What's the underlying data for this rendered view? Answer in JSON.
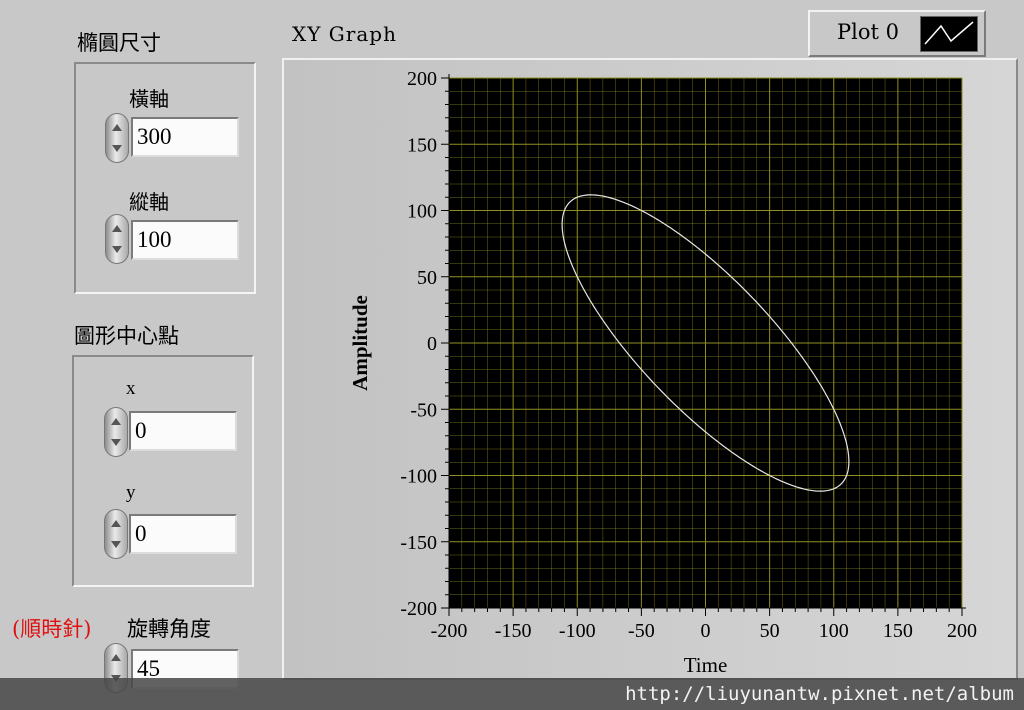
{
  "ellipse_size": {
    "title": "橢圓尺寸",
    "horizontal": {
      "label": "橫軸",
      "value": "300"
    },
    "vertical": {
      "label": "縱軸",
      "value": "100"
    }
  },
  "center_point": {
    "title": "圖形中心點",
    "x": {
      "label": "x",
      "value": "0"
    },
    "y": {
      "label": "y",
      "value": "0"
    }
  },
  "rotation": {
    "note": "(順時針)",
    "label": "旋轉角度",
    "value": "45"
  },
  "graph": {
    "title": "XY Graph",
    "legend_label": "Plot 0"
  },
  "footer": {
    "text": "http://liuyunantw.pixnet.net/album"
  },
  "colors": {
    "panel": "#c8c8c8",
    "plot_bg": "#000000",
    "grid": "#8f8f24",
    "curve": "#e6e6e6",
    "note_red": "#e01010"
  },
  "icons": {
    "spinner": "increment-decrement-icon",
    "legend": "line-plot-icon"
  },
  "chart_data": {
    "type": "line",
    "xlabel": "Time",
    "ylabel": "Amplitude",
    "xlim": [
      -200,
      200
    ],
    "ylim": [
      -200,
      200
    ],
    "x_ticks": [
      "-200",
      "-150",
      "-100",
      "-50",
      "0",
      "50",
      "100",
      "150",
      "200"
    ],
    "y_ticks": [
      "200",
      "150",
      "100",
      "50",
      "0",
      "-50",
      "-100",
      "-150",
      "-200"
    ],
    "grid": true,
    "legend_position": "top-right",
    "series": [
      {
        "name": "Plot 0",
        "shape": "ellipse",
        "center": [
          0,
          0
        ],
        "semi_major": 150,
        "semi_minor": 50,
        "rotation_deg_clockwise": 45
      }
    ]
  }
}
